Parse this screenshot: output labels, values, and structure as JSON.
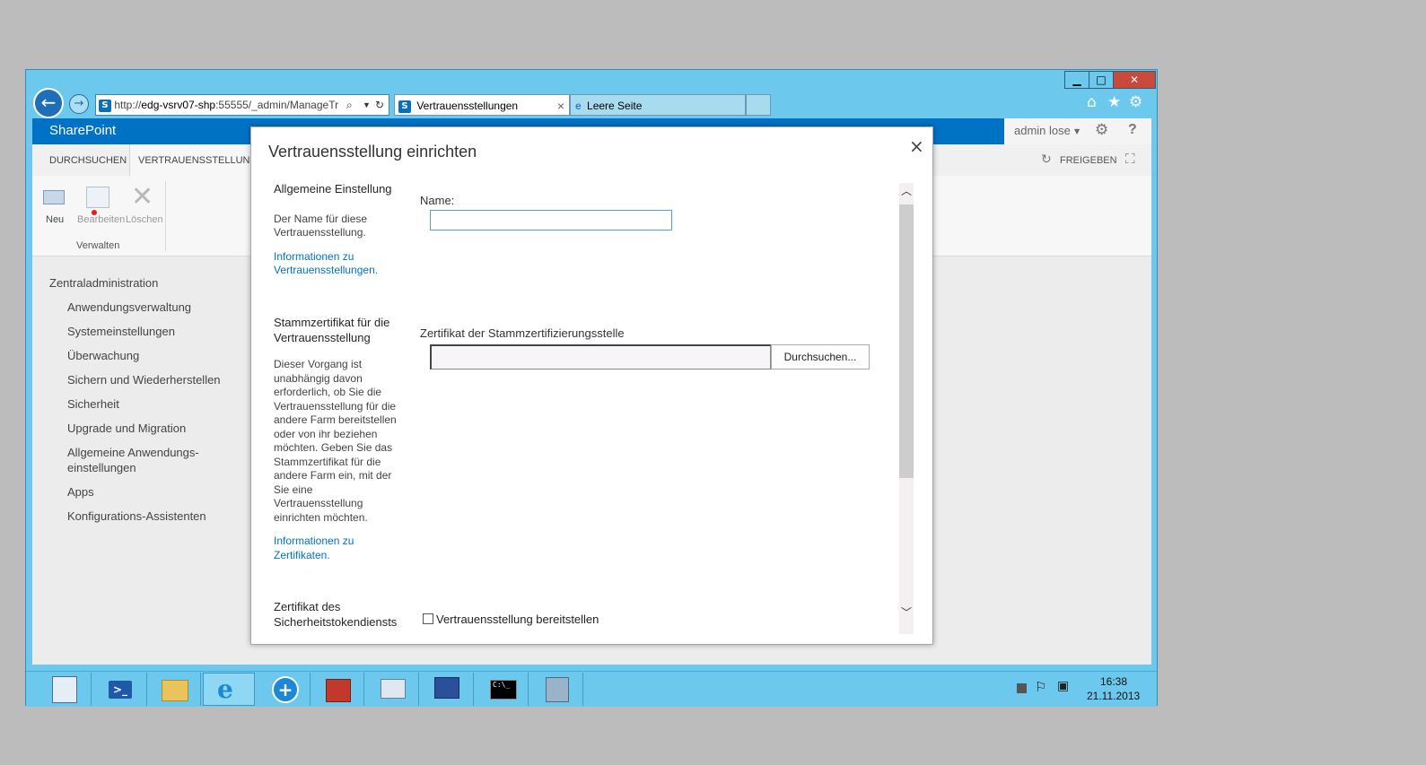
{
  "browser": {
    "url_prefix": "http://",
    "url_host": "edg-vsrv07-shp",
    "url_rest": ":55555/_admin/ManageTr",
    "tabs": [
      {
        "label": "Vertrauensstellungen",
        "close": "×"
      },
      {
        "label": "Leere Seite"
      }
    ],
    "window_buttons": {
      "minimize": "▁",
      "maximize": "□",
      "close": "✕"
    }
  },
  "suitebar": {
    "brand": "SharePoint",
    "user": "admin lose",
    "help": "?"
  },
  "ribbon": {
    "tabs": [
      "DURCHSUCHEN",
      "VERTRAUENSSTELLUNGEN"
    ],
    "share": "FREIGEBEN",
    "buttons": [
      "Neu",
      "Bearbeiten",
      "Löschen"
    ],
    "group": "Verwalten"
  },
  "nav": {
    "root": "Zentraladministration",
    "items": [
      "Anwendungsverwaltung",
      "Systemeinstellungen",
      "Überwachung",
      "Sichern und Wiederherstellen",
      "Sicherheit",
      "Upgrade und Migration",
      "Allgemeine Anwendungs-",
      "einstellungen",
      "Apps",
      "Konfigurations-Assistenten"
    ]
  },
  "dialog": {
    "title": "Vertrauensstellung einrichten",
    "close": "×",
    "section1": {
      "heading": "Allgemeine Einstellung",
      "desc": [
        "Der Name für diese",
        "Vertrauensstellung."
      ],
      "link": [
        "Informationen zu",
        "Vertrauensstellungen."
      ],
      "field_label": "Name:",
      "field_value": ""
    },
    "section2": {
      "heading": [
        "Stammzertifikat für die",
        "Vertrauensstellung"
      ],
      "desc": [
        "Dieser Vorgang ist",
        "unabhängig davon",
        "erforderlich, ob Sie die",
        "Vertrauensstellung für die",
        "andere Farm bereitstellen",
        "oder von ihr beziehen",
        "möchten. Geben Sie das",
        "Stammzertifikat für die",
        "andere Farm ein, mit der",
        "Sie eine",
        "Vertrauensstellung",
        "einrichten möchten."
      ],
      "link": [
        "Informationen zu",
        "Zertifikaten."
      ],
      "field_label": "Zertifikat der Stammzertifizierungsstelle",
      "browse": "Durchsuchen..."
    },
    "section3": {
      "heading": [
        "Zertifikat des",
        "Sicherheitstokendiensts"
      ],
      "checkbox_label": "Vertrauensstellung bereitstellen"
    }
  },
  "taskbar": {
    "time": "16:38",
    "date": "21.11.2013"
  }
}
